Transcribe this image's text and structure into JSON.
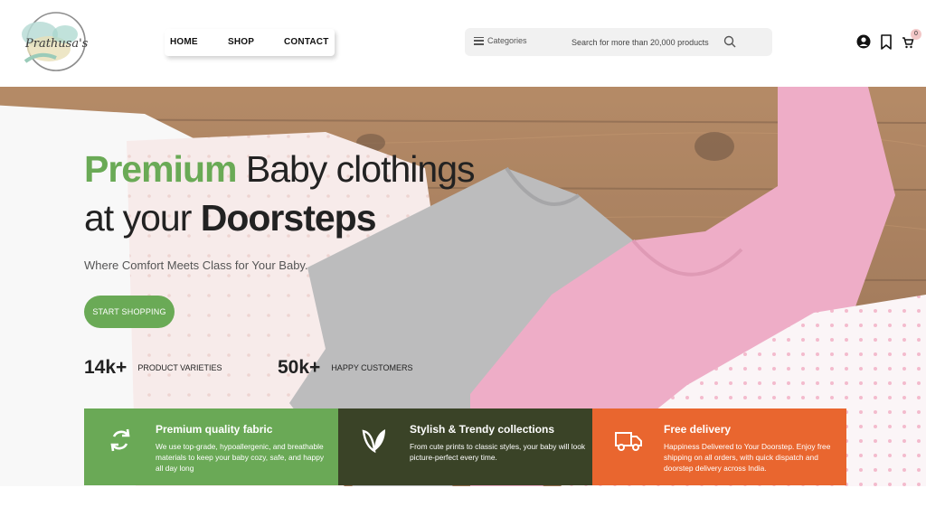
{
  "brand": {
    "logo_text": "Prathusa's"
  },
  "nav": {
    "items": [
      "HOME",
      "SHOP",
      "CONTACT"
    ]
  },
  "search": {
    "categories_label": "Categories",
    "placeholder": "Search for more than 20,000 products"
  },
  "header_icons": [
    "user-icon",
    "bookmark-icon",
    "cart-icon"
  ],
  "cart": {
    "count": "0"
  },
  "hero": {
    "headline_green": "Premium",
    "headline_rest_1": " Baby clothings",
    "headline_rest_2": "at your ",
    "headline_bold": "Doorsteps",
    "subtitle": "Where Comfort Meets Class for Your Baby.",
    "cta_label": "START SHOPPING"
  },
  "stats": [
    {
      "value": "14k+",
      "label": "PRODUCT VARIETIES"
    },
    {
      "value": "50k+",
      "label": "HAPPY CUSTOMERS"
    }
  ],
  "features": [
    {
      "icon": "recycle-icon",
      "color": "#6aa956",
      "title": "Premium quality fabric",
      "text": "We use top-grade, hypoallergenic, and breathable materials to keep your baby cozy, safe, and happy all day long"
    },
    {
      "icon": "leaf-icon",
      "color": "#3a4327",
      "title": "Stylish & Trendy collections",
      "text": "From cute prints to classic styles, your baby will look picture-perfect every time."
    },
    {
      "icon": "truck-icon",
      "color": "#e9662f",
      "title": "Free delivery",
      "text": "Happiness Delivered to Your Doorstep. Enjoy free shipping on all orders, with quick dispatch and doorstep delivery across India."
    }
  ],
  "colors": {
    "accent_green": "#6aaa56",
    "dark_olive": "#3a4327",
    "orange": "#e9662f",
    "wood": "#8a5a34",
    "pink": "#e99bbb",
    "grey_garment": "#a8a8aa"
  }
}
